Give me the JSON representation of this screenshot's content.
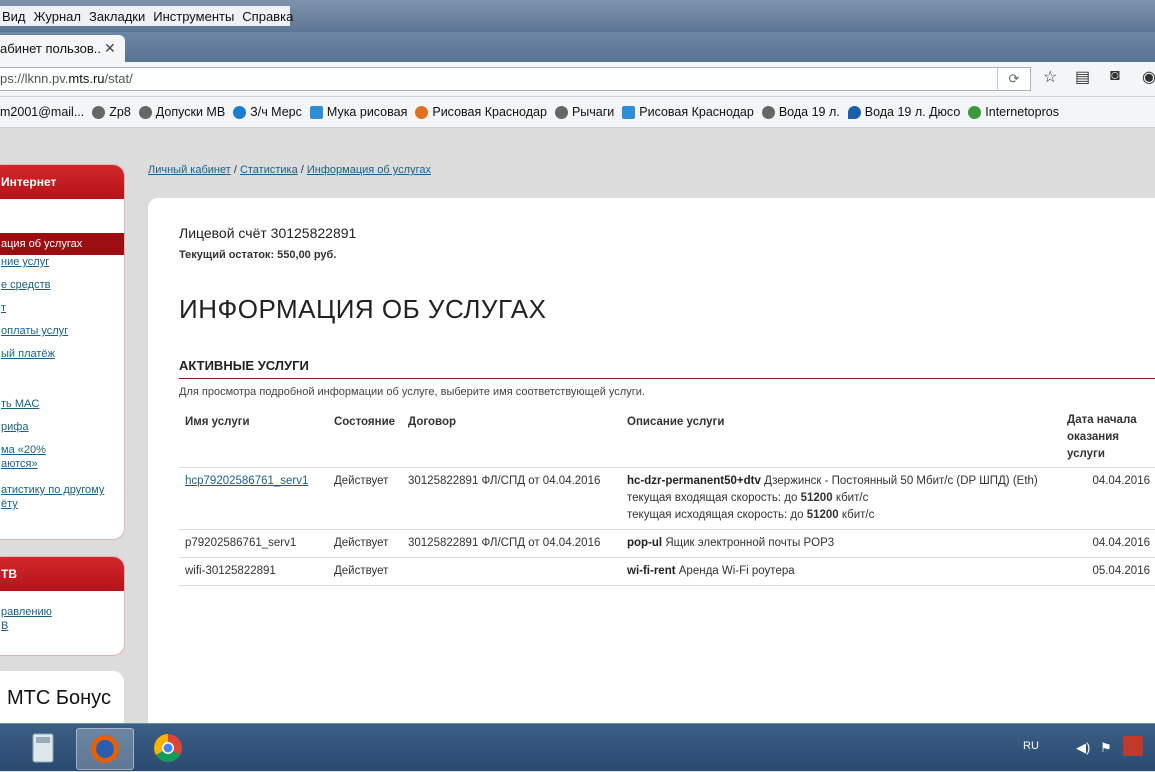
{
  "browser": {
    "menu": [
      "Вид",
      "Журнал",
      "Закладки",
      "Инструменты",
      "Справка"
    ],
    "tab_title": "абинет пользов...",
    "url_prefix": "ps://lknn.pv.",
    "url_domain": "mts.ru",
    "url_path": "/stat/",
    "bookmarks": [
      "m2001@mail...",
      "Zp8",
      "Допуски МВ",
      "З/ч Мерс",
      "Мука рисовая",
      "Рисовая Краснодар",
      "Рычаги",
      "Рисовая Краснодар",
      "Вода 19 л.",
      "Вода 19 л. Дюсо",
      "Internetopros"
    ]
  },
  "sidebar": {
    "internet_header": "Интернет",
    "internet_items": [
      "ация об услугах",
      "ние услуг",
      "е средств",
      "т",
      "оплаты услуг",
      "ый платёж",
      "ть MAC",
      "рифа",
      "ма «20%",
      "аются»",
      "атистику по другому",
      "ёту"
    ],
    "tv_header": "ТВ",
    "tv_items": [
      "равлению",
      "В"
    ],
    "bonus_label": "МТС Бонус"
  },
  "breadcrumb": {
    "home": "Личный кабинет",
    "sep": " / ",
    "stats": "Статистика",
    "current": "Информация об услугах"
  },
  "content": {
    "account": "Лицевой счёт 30125822891",
    "balance": "Текущий остаток: 550,00 руб.",
    "title": "ИНФОРМАЦИЯ ОБ УСЛУГАХ",
    "section": "АКТИВНЫЕ УСЛУГИ",
    "hint": "Для просмотра подробной информации об услуге, выберите имя соответствующей услуги.",
    "columns": [
      "Имя услуги",
      "Состояние",
      "Договор",
      "Описание услуги",
      "Дата начала оказания услуги"
    ],
    "rows": [
      {
        "name": "hcp79202586761_serv1",
        "status": "Действует",
        "contract": "30125822891 ФЛ/СПД от 04.04.2016",
        "desc_code": "hc-dzr-permanent50+dtv",
        "desc": "Дзержинск - Постоянный 50 Мбит/с (DP ШПД) (Eth)",
        "in_label": "текущая входящая скорость: до",
        "in_speed": "51200",
        "in_unit": "кбит/с",
        "out_label": "текущая исходящая скорость: до",
        "out_speed": "51200",
        "out_unit": "кбит/с",
        "date": "04.04.2016"
      },
      {
        "name": "p79202586761_serv1",
        "status": "Действует",
        "contract": "30125822891 ФЛ/СПД от 04.04.2016",
        "desc_code": "pop-ul",
        "desc": "Ящик электронной почты POP3",
        "date": "04.04.2016"
      },
      {
        "name": "wifi-30125822891",
        "status": "Действует",
        "contract": "",
        "desc_code": "wi-fi-rent",
        "desc": "Аренда Wi-Fi роутера",
        "date": "05.04.2016"
      }
    ]
  },
  "taskbar": {
    "lang": "RU"
  }
}
